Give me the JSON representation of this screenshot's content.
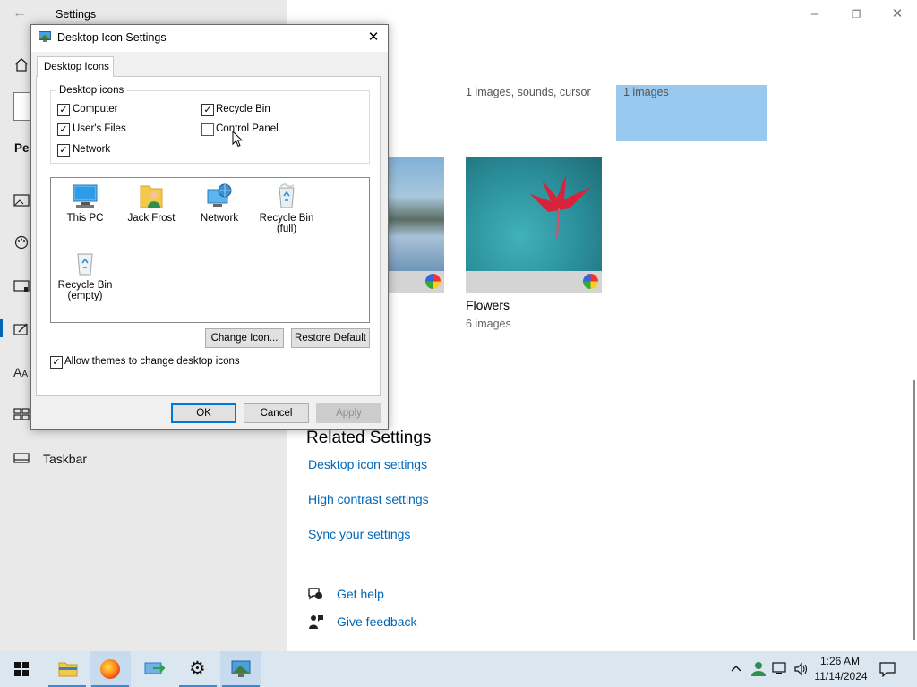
{
  "settings": {
    "title": "Settings",
    "sidebar_partial_label": "Per",
    "taskbar_item_label": "Taskbar",
    "theme_thumbs": {
      "first_info": "1 images, sounds, cursor",
      "second_info": "1 images",
      "flowers_name": "Flowers",
      "flowers_count": "6 images"
    },
    "related": {
      "heading": "Related Settings",
      "links": [
        "Desktop icon settings",
        "High contrast settings",
        "Sync your settings"
      ]
    },
    "help": {
      "get_help": "Get help",
      "give_feedback": "Give feedback"
    }
  },
  "dialog": {
    "title": "Desktop Icon Settings",
    "tab": "Desktop Icons",
    "group_label": "Desktop icons",
    "checkboxes": [
      {
        "label": "Computer",
        "checked": true
      },
      {
        "label": "Recycle Bin",
        "checked": true
      },
      {
        "label": "User's Files",
        "checked": true
      },
      {
        "label": "Control Panel",
        "checked": false
      },
      {
        "label": "Network",
        "checked": true
      }
    ],
    "icons": [
      {
        "name": "This PC",
        "icon": "monitor-icon"
      },
      {
        "name": "Jack Frost",
        "icon": "user-folder-icon"
      },
      {
        "name": "Network",
        "icon": "network-icon"
      },
      {
        "name": "Recycle Bin (full)",
        "line1": "Recycle Bin",
        "line2": "(full)",
        "icon": "recycle-bin-full-icon"
      },
      {
        "name": "Recycle Bin (empty)",
        "line1": "Recycle Bin",
        "line2": "(empty)",
        "icon": "recycle-bin-empty-icon"
      }
    ],
    "change_icon_btn": "Change Icon...",
    "restore_default_btn": "Restore Default",
    "allow_themes_label": "Allow themes to change desktop icons",
    "allow_themes_checked": true,
    "ok_btn": "OK",
    "cancel_btn": "Cancel",
    "apply_btn": "Apply"
  },
  "taskbar": {
    "time": "1:26 AM",
    "date": "11/14/2024"
  },
  "colors": {
    "accent": "#0067b8",
    "taskbar_bg": "#dbe7f0",
    "selection": "#99c9ef"
  }
}
